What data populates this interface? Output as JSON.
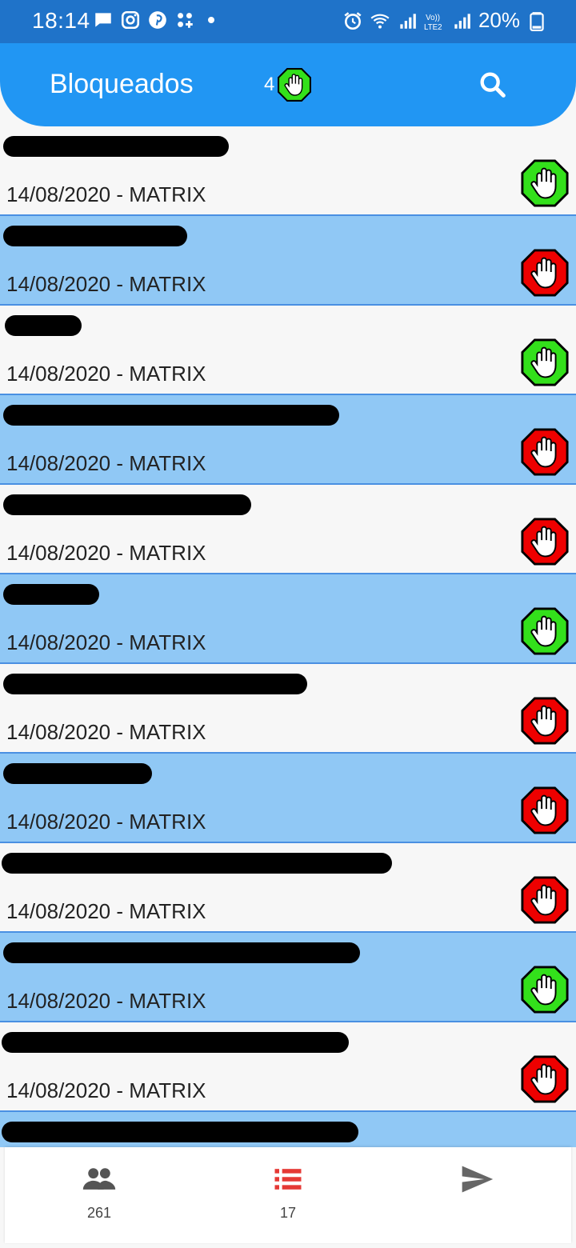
{
  "status_bar": {
    "time": "18:14",
    "battery": "20%",
    "left_icons": [
      "message-icon",
      "instagram-icon",
      "pinterest-icon",
      "apps-icon",
      "dot-icon"
    ],
    "right_icons": [
      "alarm-icon",
      "wifi-icon",
      "signal-icon",
      "volte-icon",
      "signal2-icon",
      "battery-icon"
    ]
  },
  "appbar": {
    "title": "Bloqueados",
    "count": "4",
    "search_icon": "search-icon"
  },
  "colors": {
    "statusbar": "#1f73c9",
    "appbar": "#2196f3",
    "row_blue": "#90c8f5",
    "divider": "#4a90e2",
    "stop_green": "#33e01b",
    "stop_red": "#ee0000",
    "nav_active": "#e53935"
  },
  "rows": [
    {
      "subtitle": "14/08/2020 - MATRIX",
      "status": "green"
    },
    {
      "subtitle": "14/08/2020 - MATRIX",
      "status": "red"
    },
    {
      "subtitle": "14/08/2020 - MATRIX",
      "status": "green"
    },
    {
      "subtitle": "14/08/2020 - MATRIX",
      "status": "red"
    },
    {
      "subtitle": "14/08/2020 - MATRIX",
      "status": "red"
    },
    {
      "subtitle": "14/08/2020 - MATRIX",
      "status": "green"
    },
    {
      "subtitle": "14/08/2020 - MATRIX",
      "status": "red"
    },
    {
      "subtitle": "14/08/2020 - MATRIX",
      "status": "red"
    },
    {
      "subtitle": "14/08/2020 - MATRIX",
      "status": "red"
    },
    {
      "subtitle": "14/08/2020 - MATRIX",
      "status": "green"
    },
    {
      "subtitle": "14/08/2020 - MATRIX",
      "status": "red"
    }
  ],
  "bottom_nav": [
    {
      "icon": "people-icon",
      "label": "261",
      "active": false
    },
    {
      "icon": "list-icon",
      "label": "17",
      "active": true
    },
    {
      "icon": "send-icon",
      "label": "",
      "active": false
    }
  ]
}
